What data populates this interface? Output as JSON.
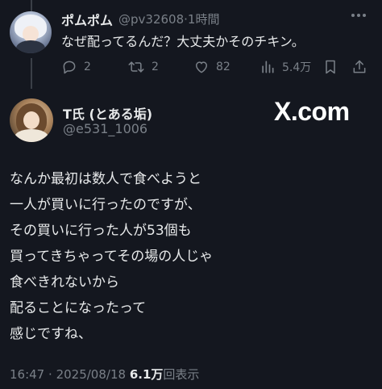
{
  "reply_tweet": {
    "display_name": "ポムポム",
    "handle": "@pv32608",
    "separator": "·",
    "time": "1時間",
    "text": "なぜ配ってるんだ？大丈夫かそのチキン。",
    "actions": {
      "reply_icon": "reply-icon",
      "reply_count": "2",
      "retweet_icon": "retweet-icon",
      "retweet_count": "2",
      "like_icon": "heart-icon",
      "like_count": "82",
      "views_icon": "bar-chart-icon",
      "views_count": "5.4万",
      "bookmark_icon": "bookmark-icon",
      "share_icon": "share-icon"
    }
  },
  "main_tweet": {
    "display_name": "T氏 (とある垢)",
    "handle": "@e531_1006",
    "body_lines": [
      "なんか最初は数人で食べようと",
      "一人が買いに行ったのですが、",
      "その買いに行った人が53個も",
      "買ってきちゃってその場の人じゃ",
      "食べきれないから",
      "配ることになったって",
      "感じですね、"
    ],
    "footer": {
      "time": "16:47",
      "dot": "·",
      "date": "2025/08/18",
      "views_number": "6.1万",
      "views_label": "回表示"
    }
  },
  "watermark": {
    "text": "X.com"
  },
  "colors": {
    "background": "#14171f",
    "text_primary": "#e7e9ea",
    "text_secondary": "#7a8088"
  }
}
